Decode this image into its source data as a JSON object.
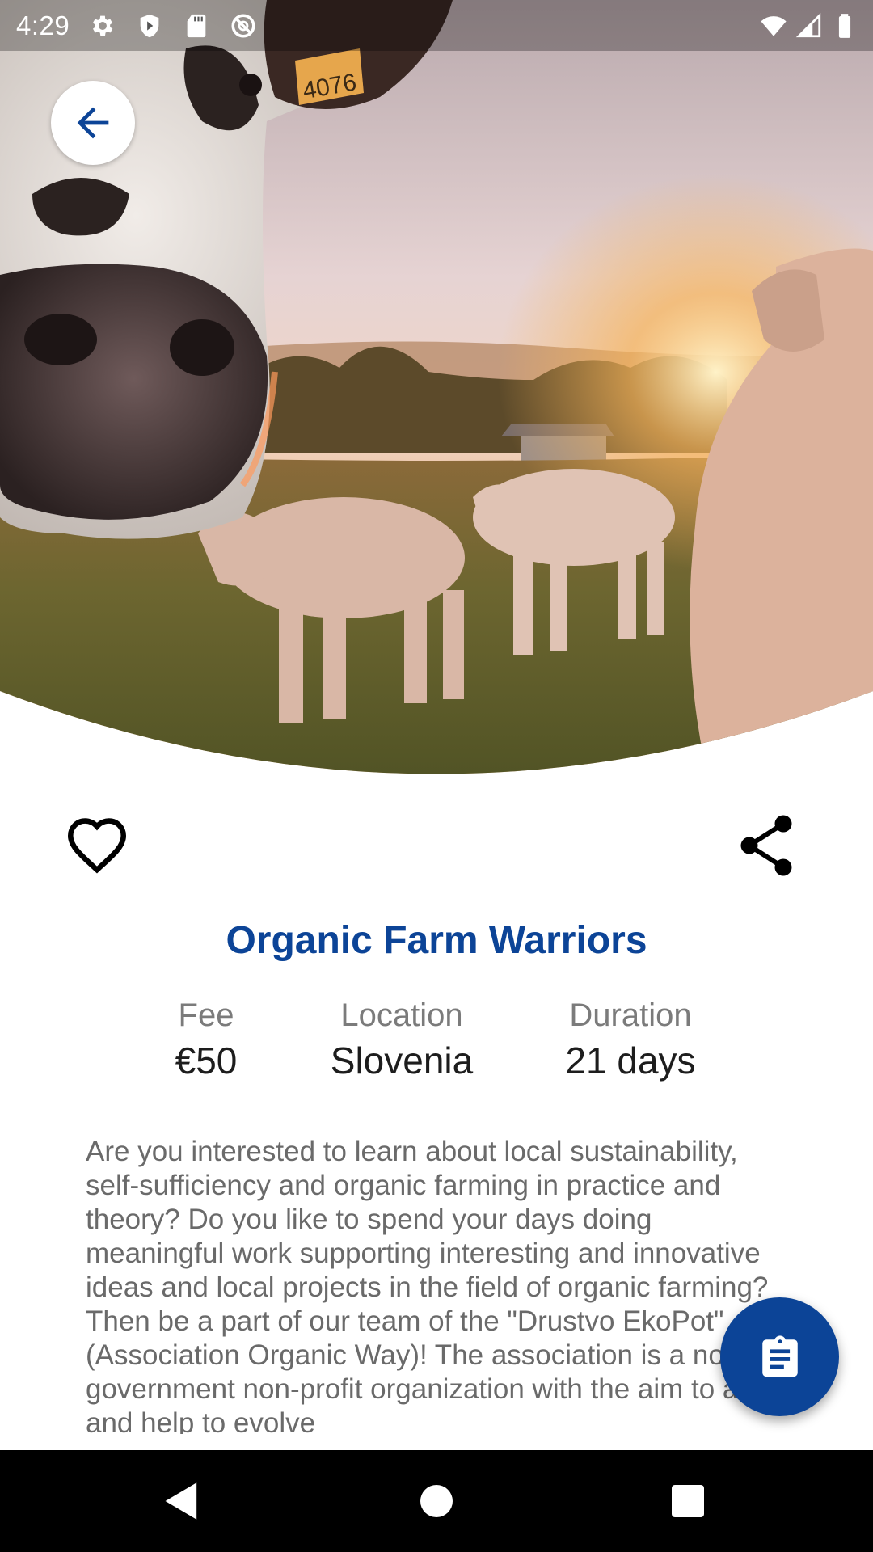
{
  "status_bar": {
    "time": "4:29",
    "left_icons": [
      "settings-icon",
      "shield-icon",
      "sd-card-icon",
      "do-not-disturb-icon"
    ],
    "right_icons": [
      "wifi-icon",
      "cell-signal-icon",
      "battery-icon"
    ]
  },
  "hero": {
    "image": "cows-in-field-at-sunset-photo",
    "ear_tag": "4076"
  },
  "toolbar": {
    "back_icon": "arrow-left-icon",
    "favorite_icon": "heart-outline-icon",
    "share_icon": "share-icon"
  },
  "event": {
    "title": "Organic Farm Warriors",
    "fee_label": "Fee",
    "fee_value": "€50",
    "location_label": "Location",
    "location_value": "Slovenia",
    "duration_label": "Duration",
    "duration_value": "21 days",
    "description": "Are you interested to learn about local sustainability, self-sufficiency and organic farming in practice and theory? Do you like to spend your days doing meaningful work supporting interesting and innovative ideas and local projects in the field of organic farming? Then be a part of our team of the \"Drustvo EkoPot\" (Association Organic Way)! The association is a non-government non-profit organization with the aim to assist and help to evolve"
  },
  "fab": {
    "icon": "clipboard-icon"
  },
  "nav_bar": {
    "icons": [
      "nav-back-icon",
      "nav-home-icon",
      "nav-recents-icon"
    ]
  },
  "colors": {
    "accent": "#0c4497",
    "text_primary": "#1d1d1d",
    "text_secondary": "#7b7b7b",
    "nav_bar": "#000000"
  }
}
